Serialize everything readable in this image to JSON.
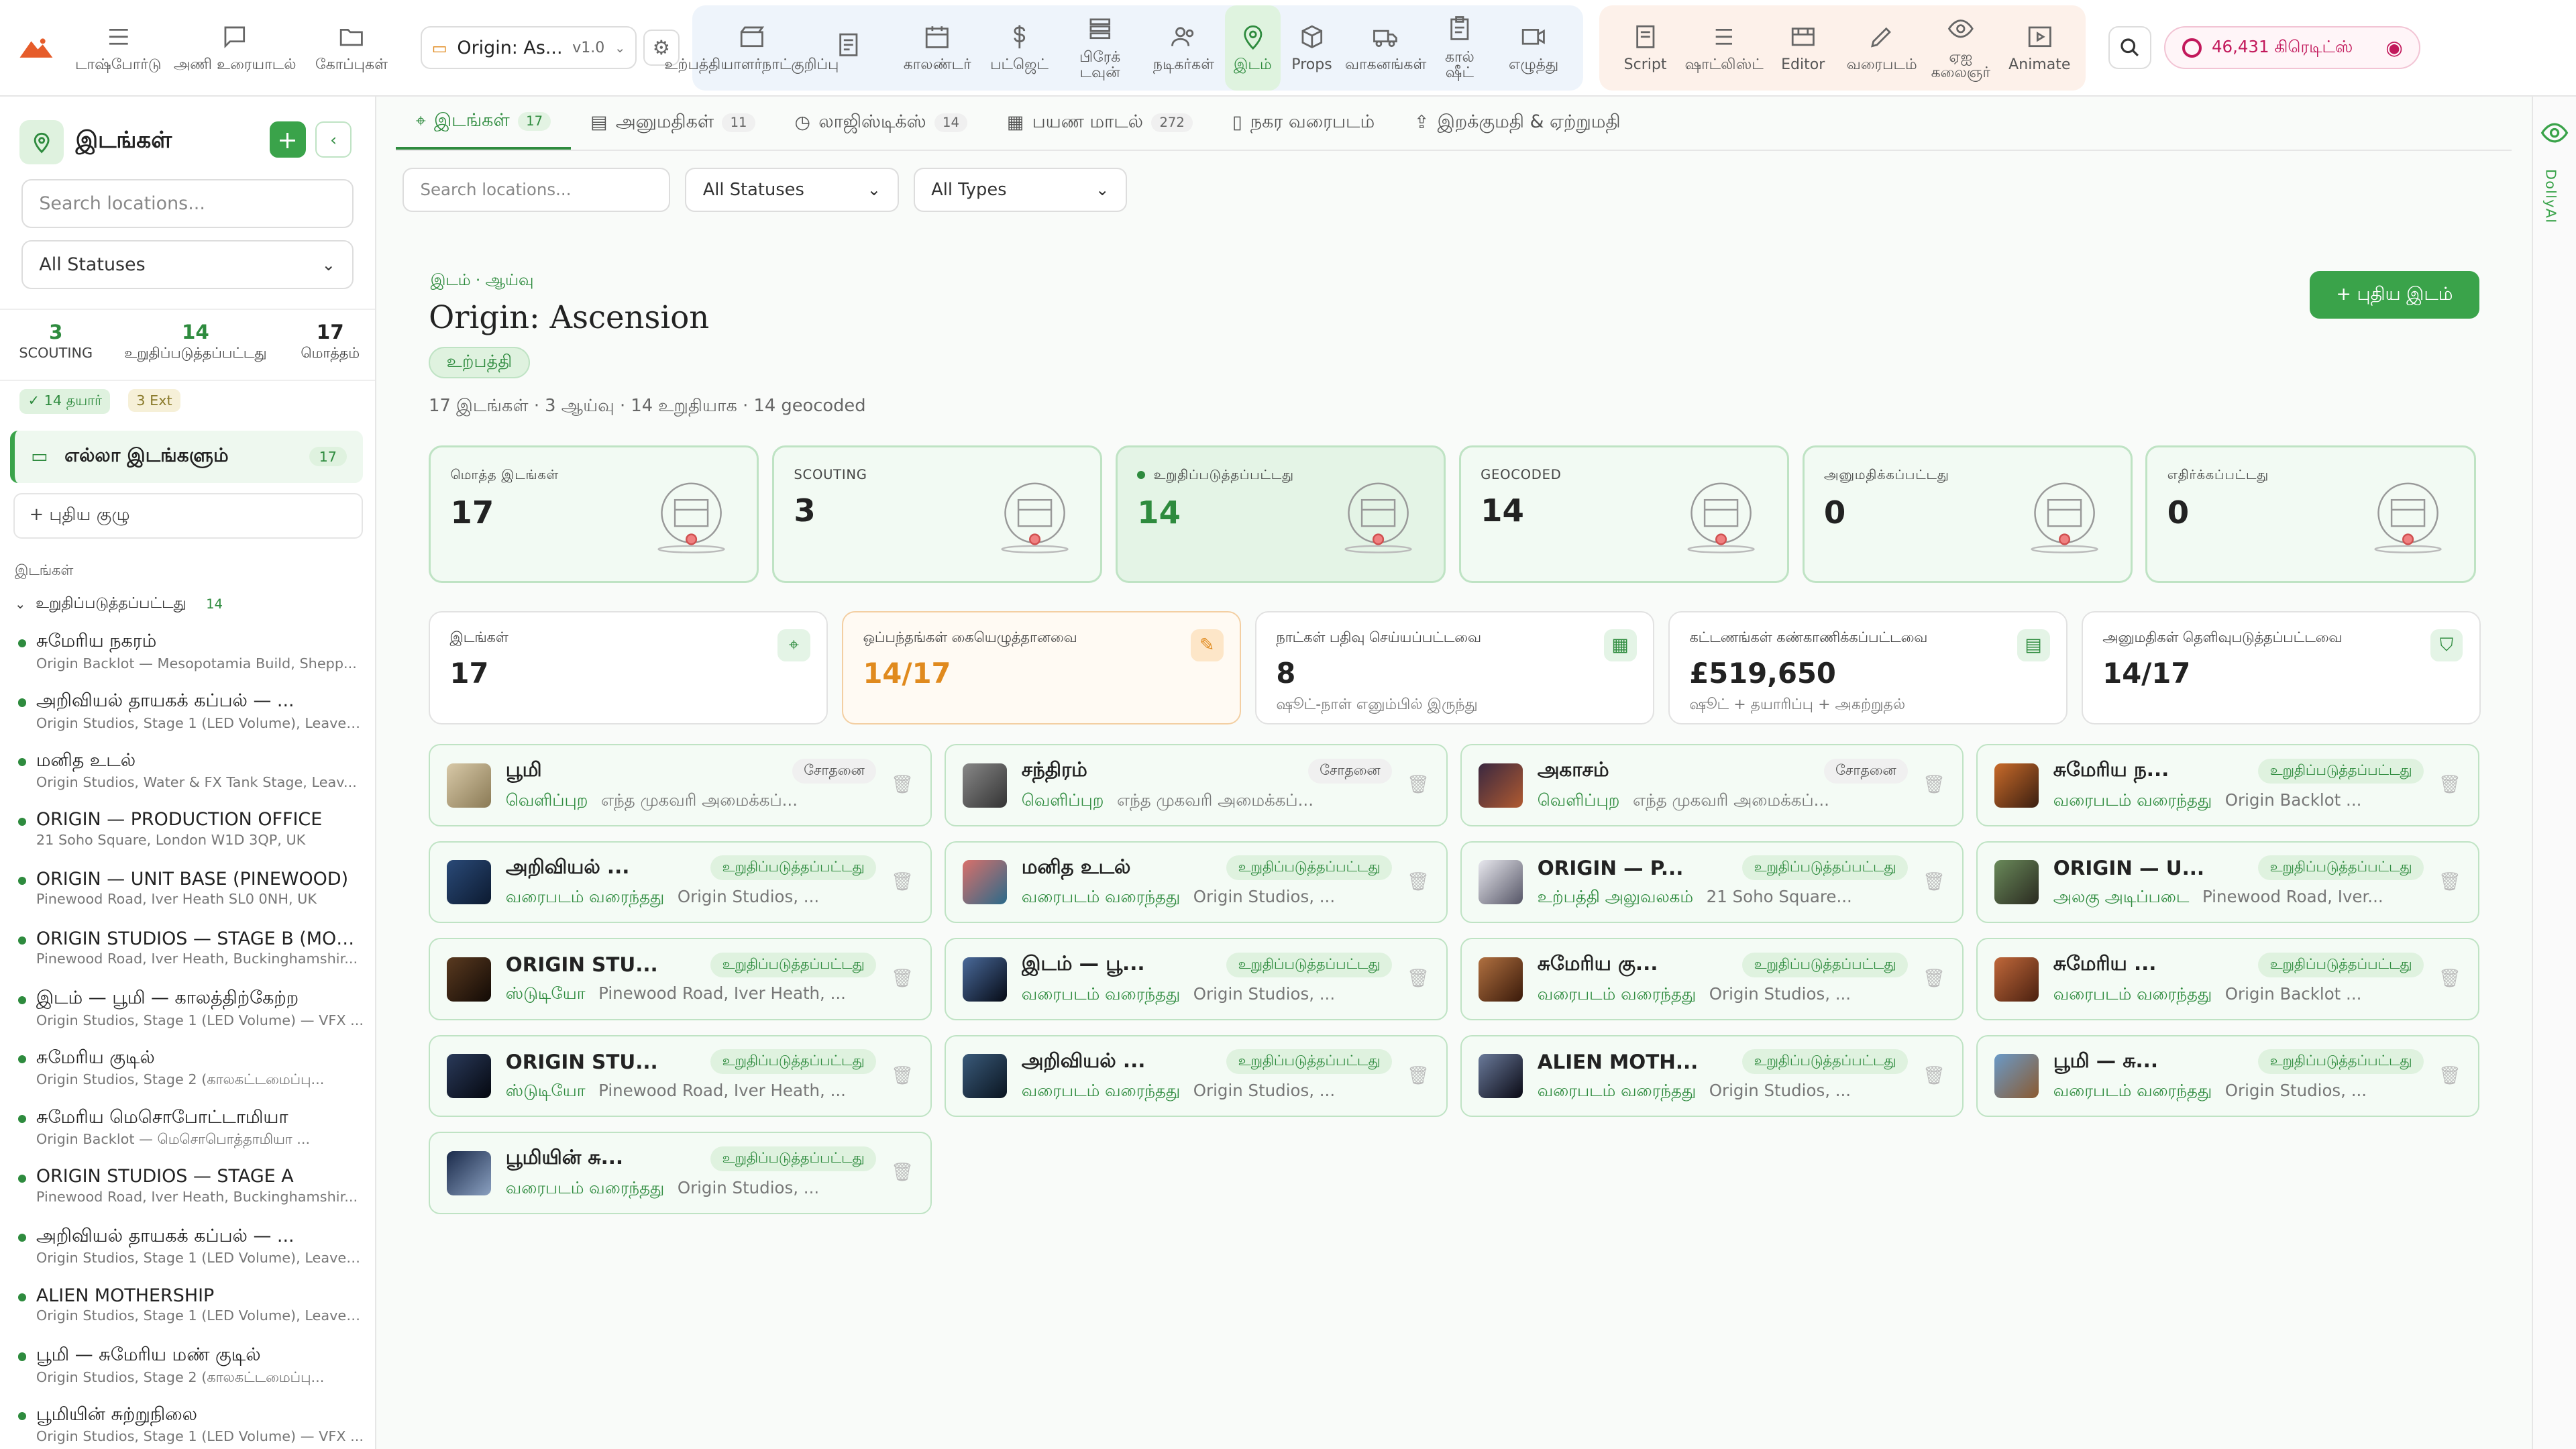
{
  "nav": {
    "items": [
      {
        "key": "dashboard",
        "label": "டாஷ்போர்டு",
        "icon": "menu-icon"
      },
      {
        "key": "chat",
        "label": "அணி உரையாடல்",
        "icon": "chat-icon"
      },
      {
        "key": "files",
        "label": "கோப்புகள்",
        "icon": "folder-icon"
      }
    ],
    "project_name": "Origin: As...",
    "project_version": "v1.0",
    "blue_group": [
      {
        "key": "production",
        "label": "உற்பத்தியாளர்நாட்குறிப்பு",
        "icon": "clapper-icon"
      },
      {
        "key": "notes",
        "label": "",
        "icon": "document-icon"
      },
      {
        "key": "calendar",
        "label": "காலண்டர்",
        "icon": "calendar-icon"
      },
      {
        "key": "budget",
        "label": "பட்ஜெட்",
        "icon": "dollar-icon"
      },
      {
        "key": "breakdown",
        "label": "பிரேக் டவுன்",
        "icon": "layers-icon"
      },
      {
        "key": "cast",
        "label": "நடிகர்கள்",
        "icon": "people-icon"
      },
      {
        "key": "location",
        "label": "இடம்",
        "icon": "pin-icon"
      },
      {
        "key": "props",
        "label": "Props",
        "icon": "cube-icon"
      },
      {
        "key": "vehicles",
        "label": "வாகனங்கள்",
        "icon": "truck-icon"
      },
      {
        "key": "callsheet",
        "label": "கால் ஷீட்",
        "icon": "clipboard-icon"
      },
      {
        "key": "write",
        "label": "எழுத்து",
        "icon": "video-icon"
      }
    ],
    "orange_group": [
      {
        "key": "script",
        "label": "Script",
        "icon": "script-icon"
      },
      {
        "key": "shotlist",
        "label": "ஷாட்லிஸ்ட்",
        "icon": "list-icon"
      },
      {
        "key": "editor",
        "label": "Editor",
        "icon": "editor-icon"
      },
      {
        "key": "draw",
        "label": "வரைபடம்",
        "icon": "pencil-icon"
      },
      {
        "key": "ai",
        "label": "ஏஐ கலைஞர்",
        "icon": "eye-icon"
      },
      {
        "key": "animate",
        "label": "Animate",
        "icon": "play-icon"
      }
    ],
    "credits": "46,431 கிரெடிட்ஸ்"
  },
  "sidebar": {
    "title": "இடங்கள்",
    "search_placeholder": "Search locations...",
    "status_filter": "All Statuses",
    "stats": [
      {
        "value": "3",
        "label": "SCOUTING",
        "color": "#2e8b3e"
      },
      {
        "value": "14",
        "label": "உறுதிப்படுத்தப்பட்டது",
        "color": "#2e8b3e"
      },
      {
        "value": "17",
        "label": "மொத்தம்",
        "color": "#222"
      }
    ],
    "badges": [
      "✓ 14 தயார்",
      "3 Ext"
    ],
    "all_locations": "எல்லா இடங்களும்",
    "all_count": "17",
    "new_group": "+ புதிய குழு",
    "section_label": "இடங்கள்",
    "group_label": "உறுதிப்படுத்தப்பட்டது",
    "group_count": "14",
    "items": [
      {
        "title": "சுமேரிய நகரம்",
        "sub": "Origin Backlot — Mesopotamia Build, Shepp..."
      },
      {
        "title": "அறிவியல் தாயகக் கப்பல் — ...",
        "sub": "Origin Studios, Stage 1 (LED Volume), Leaves..."
      },
      {
        "title": "மனித உடல்",
        "sub": "Origin Studios, Water & FX Tank Stage, Leav..."
      },
      {
        "title": "ORIGIN — PRODUCTION OFFICE",
        "sub": "21 Soho Square, London W1D 3QP, UK"
      },
      {
        "title": "ORIGIN — UNIT BASE (PINEWOOD)",
        "sub": "Pinewood Road, Iver Heath SL0 0NH, UK"
      },
      {
        "title": "ORIGIN STUDIOS — STAGE B (MOTH...",
        "sub": "Pinewood Road, Iver Heath, Buckinghamshir..."
      },
      {
        "title": "இடம் — பூமி — காலத்திற்கேற்ற",
        "sub": "Origin Studios, Stage 1 (LED Volume) — VFX ..."
      },
      {
        "title": "சுமேரிய குடில்",
        "sub": "Origin Studios, Stage 2 (காலகட்டமைப்பு..."
      },
      {
        "title": "சுமேரிய மெசொபோட்டாமியா",
        "sub": "Origin Backlot — மெசொபொத்தாமியா ..."
      },
      {
        "title": "ORIGIN STUDIOS — STAGE A",
        "sub": "Pinewood Road, Iver Heath, Buckinghamshir..."
      },
      {
        "title": "அறிவியல் தாயகக் கப்பல் — ...",
        "sub": "Origin Studios, Stage 1 (LED Volume), Leaves..."
      },
      {
        "title": "ALIEN MOTHERSHIP",
        "sub": "Origin Studios, Stage 1 (LED Volume), Leaves..."
      },
      {
        "title": "பூமி — சுமேரிய மண் குடில்",
        "sub": "Origin Studios, Stage 2 (காலகட்டமைப்பு..."
      },
      {
        "title": "பூமியின் சுற்றுநிலை",
        "sub": "Origin Studios, Stage 1 (LED Volume) — VFX ..."
      }
    ]
  },
  "tabs": [
    {
      "label": "இடங்கள்",
      "count": "17",
      "icon": "pin-icon",
      "active": true
    },
    {
      "label": "அனுமதிகள்",
      "count": "11",
      "icon": "doc-icon"
    },
    {
      "label": "லாஜிஸ்டிக்ஸ்",
      "count": "14",
      "icon": "clock-icon"
    },
    {
      "label": "பயண மாடல்",
      "count": "272",
      "icon": "grid-icon"
    },
    {
      "label": "நகர வரைபடம்",
      "count": "",
      "icon": "map-icon"
    },
    {
      "label": "இறக்குமதி & ஏற்றுமதி",
      "count": "",
      "icon": "upload-icon"
    }
  ],
  "filters": {
    "search_placeholder": "Search locations...",
    "status": "All Statuses",
    "type": "All Types"
  },
  "header": {
    "breadcrumb": "இடம் · ஆய்வு",
    "title": "Origin: Ascension",
    "tag": "உற்பத்தி",
    "summary": "17 இடங்கள் · 3 ஆய்வு · 14 உறுதியாக · 14 geocoded",
    "new_button": "+ புதிய இடம்"
  },
  "stat_cards": [
    {
      "label": "மொத்த இடங்கள்",
      "value": "17"
    },
    {
      "label": "SCOUTING",
      "value": "3"
    },
    {
      "label": "உறுதிப்படுத்தப்பட்டது",
      "value": "14"
    },
    {
      "label": "GEOCODED",
      "value": "14"
    },
    {
      "label": "அனுமதிக்கப்பட்டது",
      "value": "0"
    },
    {
      "label": "எதிர்க்கப்பட்டது",
      "value": "0"
    }
  ],
  "metric_cards": [
    {
      "label": "இடங்கள்",
      "value": "17",
      "sub": "",
      "icon": "pin-icon",
      "color": "#222"
    },
    {
      "label": "ஒப்பந்தங்கள் கையெழுத்தானவை",
      "value": "14/17",
      "sub": "",
      "icon": "sign-icon",
      "color": "#e08a1e"
    },
    {
      "label": "நாட்கள் பதிவு செய்யப்பட்டவை",
      "value": "8",
      "sub": "ஷூட்-நாள் எனும்பில் இருந்து",
      "icon": "calendar-icon",
      "color": "#222"
    },
    {
      "label": "கட்டணங்கள் கண்காணிக்கப்பட்டவை",
      "value": "£519,650",
      "sub": "ஷூட் + தயாரிப்பு + அகற்றுதல்",
      "icon": "receipt-icon",
      "color": "#222"
    },
    {
      "label": "அனுமதிகள் தெளிவுபடுத்தப்பட்டவை",
      "value": "14/17",
      "sub": "",
      "icon": "shield-icon",
      "color": "#222"
    }
  ],
  "locations": [
    {
      "name": "பூமி",
      "status": "சோதனை",
      "type": "வெளிப்புற",
      "addr": "எந்த முகவரி அமைக்கப்...",
      "c1": "#d8c9a8",
      "c2": "#8a7a55"
    },
    {
      "name": "சந்திரம்",
      "status": "சோதனை",
      "type": "வெளிப்புற",
      "addr": "எந்த முகவரி அமைக்கப்...",
      "c1": "#888",
      "c2": "#333"
    },
    {
      "name": "அகாசம்",
      "status": "சோதனை",
      "type": "வெளிப்புற",
      "addr": "எந்த முகவரி அமைக்கப்...",
      "c1": "#3a2840",
      "c2": "#b05a30"
    },
    {
      "name": "சுமேரிய ந...",
      "status": "உறுதிப்படுத்தப்பட்டது",
      "type": "வரைபடம் வரைந்தது",
      "addr": "Origin Backlot ...",
      "c1": "#c96b2a",
      "c2": "#3a1e10"
    },
    {
      "name": "அறிவியல் ...",
      "status": "உறுதிப்படுத்தப்பட்டது",
      "type": "வரைபடம் வரைந்தது",
      "addr": "Origin Studios, ...",
      "c1": "#2a4a78",
      "c2": "#0c1a30"
    },
    {
      "name": "மனித உடல்",
      "status": "உறுதிப்படுத்தப்பட்டது",
      "type": "வரைபடம் வரைந்தது",
      "addr": "Origin Studios, ...",
      "c1": "#d9706a",
      "c2": "#2a6a8a"
    },
    {
      "name": "ORIGIN — P...",
      "status": "உறுதிப்படுத்தப்பட்டது",
      "type": "உற்பத்தி அலுவலகம்",
      "addr": "21 Soho Square...",
      "c1": "#e8e8ee",
      "c2": "#556"
    },
    {
      "name": "ORIGIN — U...",
      "status": "உறுதிப்படுத்தப்பட்டது",
      "type": "அலகு அடிப்படை",
      "addr": "Pinewood Road, Iver...",
      "c1": "#6a8a5a",
      "c2": "#2a2a20"
    },
    {
      "name": "ORIGIN STU...",
      "status": "உறுதிப்படுத்தப்பட்டது",
      "type": "ஸ்டுடியோ",
      "addr": "Pinewood Road, Iver Heath, ...",
      "c1": "#5a3a20",
      "c2": "#120a05"
    },
    {
      "name": "இடம் — பூ...",
      "status": "உறுதிப்படுத்தப்பட்டது",
      "type": "வரைபடம் வரைந்தது",
      "addr": "Origin Studios, ...",
      "c1": "#4a6a9a",
      "c2": "#050a15"
    },
    {
      "name": "சுமேரிய கு...",
      "status": "உறுதிப்படுத்தப்பட்டது",
      "type": "வரைபடம் வரைந்தது",
      "addr": "Origin Studios, ...",
      "c1": "#b07040",
      "c2": "#3a1a0a"
    },
    {
      "name": "சுமேரிய ...",
      "status": "உறுதிப்படுத்தப்பட்டது",
      "type": "வரைபடம் வரைந்தது",
      "addr": "Origin Backlot ...",
      "c1": "#c0683a",
      "c2": "#4a2010"
    },
    {
      "name": "ORIGIN STU...",
      "status": "உறுதிப்படுத்தப்பட்டது",
      "type": "ஸ்டுடியோ",
      "addr": "Pinewood Road, Iver Heath, ...",
      "c1": "#2a3a5a",
      "c2": "#050810"
    },
    {
      "name": "அறிவியல் ...",
      "status": "உறுதிப்படுத்தப்பட்டது",
      "type": "வரைபடம் வரைந்தது",
      "addr": "Origin Studios, ...",
      "c1": "#3a5a7a",
      "c2": "#0a1520"
    },
    {
      "name": "ALIEN MOTH...",
      "status": "உறுதிப்படுத்தப்பட்டது",
      "type": "வரைபடம் வரைந்தது",
      "addr": "Origin Studios, ...",
      "c1": "#6a7a9a",
      "c2": "#0a0a15"
    },
    {
      "name": "பூமி — சு...",
      "status": "உறுதிப்படுத்தப்பட்டது",
      "type": "வரைபடம் வரைந்தது",
      "addr": "Origin Studios, ...",
      "c1": "#6a9ac8",
      "c2": "#8a5a30"
    },
    {
      "name": "பூமியின் சு...",
      "status": "உறுதிப்படுத்தப்பட்டது",
      "type": "வரைபடம் வரைந்தது",
      "addr": "Origin Studios, ...",
      "c1": "#1a2a4a",
      "c2": "#8aa0c0"
    }
  ],
  "right_rail": {
    "label": "DollyAI"
  },
  "colors": {
    "accent": "#2e8b3e",
    "accent_bg": "#dff2df",
    "orange": "#e08a1e",
    "credits": "#c2185b"
  }
}
